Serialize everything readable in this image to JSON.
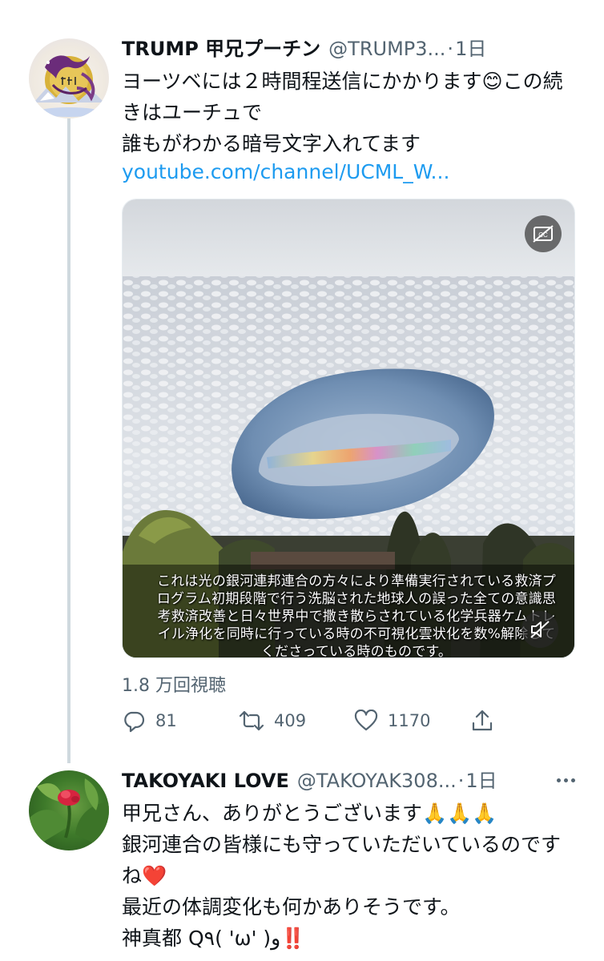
{
  "tweet1": {
    "display_name": "TRUMP 甲兄プーチン",
    "handle": "@TRUMP3...",
    "separator": "·",
    "time": "1日",
    "text": "ヨーツベには２時間程送信にかかります😊この続きはユーチュで\n誰もがわかる暗号文字入れてます",
    "link": "youtube.com/channel/UCML_W...",
    "avatar_icon": "dragon-moon-avatar",
    "media": {
      "caption": "これは光の銀河連邦連合の方々により準備実行されている救済プログラム初期段階で行う洗脳された地球人の誤った全ての意識思考救済改善と日々世界中で撒き散らされている化学兵器ケムトレイル浄化を同時に行っている時の不可視化雲状化を数%解除してくださっている時のものです。",
      "cc_icon": "closed-captions-icon",
      "volume_icon": "mute-icon"
    },
    "views": "1.8 万回視聴",
    "actions": {
      "reply_count": "81",
      "retweet_count": "409",
      "like_count": "1170"
    }
  },
  "tweet2": {
    "display_name": "TAKOYAKI LOVE",
    "handle": "@TAKOYAK308...",
    "separator": "·",
    "time": "1日",
    "text": "甲兄さん、ありがとうございます🙏🙏🙏\n銀河連合の皆様にも守っていただいているのですね❤️\n最近の体調変化も何かありそうです。\n神真都 Q٩( 'ω' )و‼️",
    "avatar_icon": "red-flower-avatar"
  },
  "colors": {
    "accent": "#1d9bf0",
    "secondary_text": "#536471",
    "thread_line": "#cfd9de"
  }
}
